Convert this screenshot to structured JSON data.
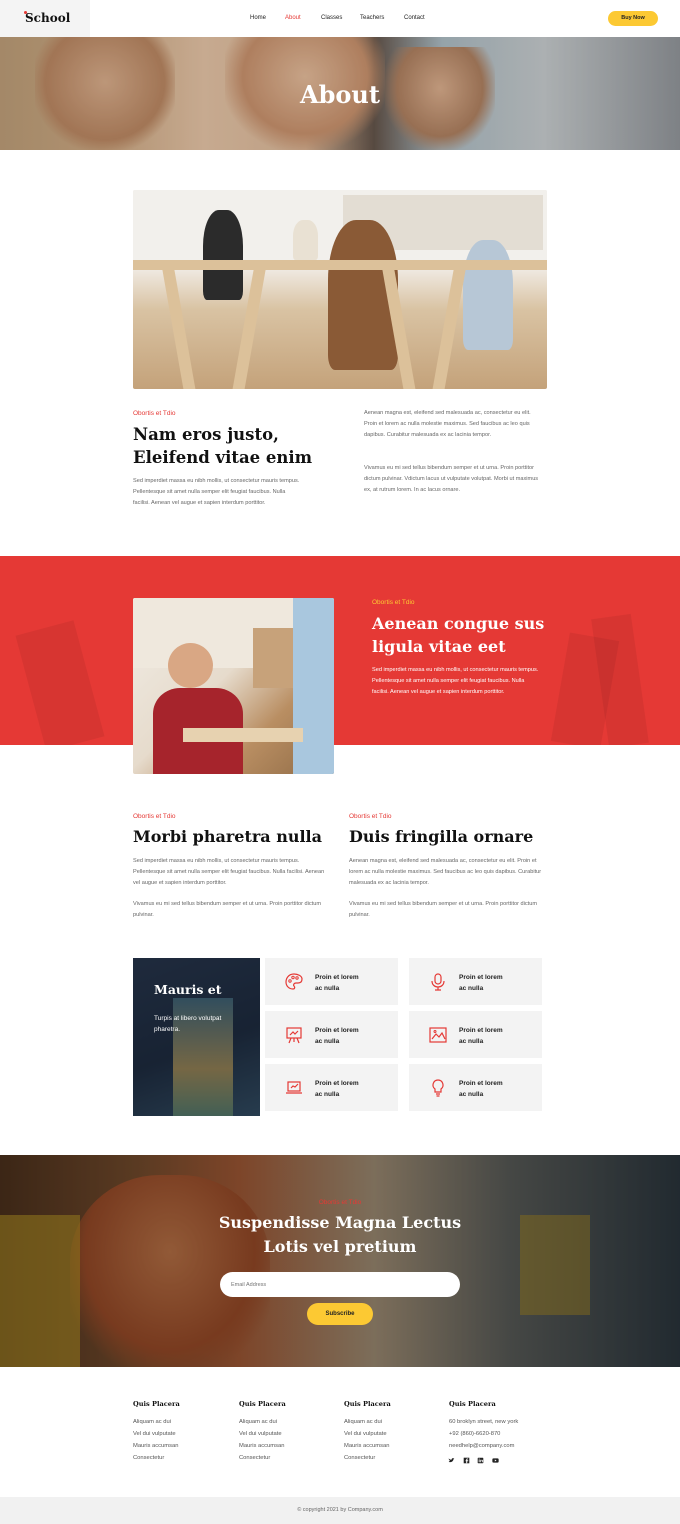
{
  "header": {
    "logo": "School",
    "nav": [
      "Home",
      "About",
      "Classes",
      "Teachers",
      "Contact"
    ],
    "active": "About",
    "cta": "Buy Now"
  },
  "hero": {
    "title": "About"
  },
  "intro": {
    "eyebrow": "Obortis et Tdio",
    "title_line1": "Nam eros justo,",
    "title_line2": "Eleifend vitae enim",
    "body": "Sed imperdiet massa eu nibh mollis, ut consectetur mauris tempus. Pellentesque sit amet nulla semper elit feugiat faucibus. Nulla facilisi. Aenean vel augue et sapien interdum porttitor.",
    "right_p1": "Aenean magna est, eleifend sed malesuada ac, consectetur eu elit. Proin et lorem ac nulla molestie maximus. Sed faucibus ac leo quis dapibus. Curabitur malesuada ex ac lacinia tempor.",
    "right_p2": "Vivamus eu mi sed tellus bibendum semper et ut urna. Proin porttitor dictum pulvinar. Vdictum lacus ut vulputate volutpat. Morbi ut maximus ex, at rutrum lorem. In ac lacus ornare."
  },
  "red_section": {
    "eyebrow": "Obortis et Tdio",
    "title_line1": "Aenean congue sus",
    "title_line2": "ligula vitae eet",
    "body": "Sed imperdiet massa eu nibh mollis, ut consectetur mauris tempus. Pellentesque sit amet nulla semper elit feugiat faucibus. Nulla facilisi. Aenean vel augue et sapien interdum porttitor."
  },
  "two_col": {
    "left": {
      "eyebrow": "Obortis et Tdio",
      "title": "Morbi pharetra nulla",
      "p1": "Sed imperdiet massa eu nibh mollis, ut consectetur mauris tempus. Pellentesque sit amet nulla semper elit feugiat faucibus. Nulla facilisi. Aenean vel augue et sapien interdum porttitor.",
      "p2": "Vivamus eu mi sed tellus bibendum semper et ut urna. Proin porttitor dictum pulvinar."
    },
    "right": {
      "eyebrow": "Obortis et Tdio",
      "title": "Duis fringilla ornare",
      "p1": "Aenean magna est, eleifend sed malesuada ac, consectetur eu elit. Proin et lorem ac nulla molestie maximus. Sed faucibus ac leo quis dapibus. Curabitur malesuada ex ac lacinia tempor.",
      "p2": "Vivamus eu mi sed tellus bibendum semper et ut urna. Proin porttitor dictum pulvinar."
    }
  },
  "features": {
    "card_title": "Mauris et",
    "card_text": "Turpis at libero volutpat pharetra.",
    "items": [
      {
        "line1": "Proin et lorem",
        "line2": "ac nulla",
        "icon": "palette-icon"
      },
      {
        "line1": "Proin et lorem",
        "line2": "ac nulla",
        "icon": "microphone-icon"
      },
      {
        "line1": "Proin et lorem",
        "line2": "ac nulla",
        "icon": "presentation-board-icon"
      },
      {
        "line1": "Proin et lorem",
        "line2": "ac nulla",
        "icon": "image-chart-icon"
      },
      {
        "line1": "Proin et lorem",
        "line2": "ac nulla",
        "icon": "laptop-chart-icon"
      },
      {
        "line1": "Proin et lorem",
        "line2": "ac nulla",
        "icon": "lightbulb-icon"
      }
    ]
  },
  "subscribe": {
    "eyebrow": "Obortis et Tdio",
    "title_line1": "Suspendisse Magna Lectus",
    "title_line2": "Lotis vel pretium",
    "placeholder": "Email Address",
    "button": "Subscribe"
  },
  "footer": {
    "columns": [
      {
        "title": "Quis Placera",
        "links": [
          "Aliquam ac dui",
          "Vel dui vulputate",
          "Mauris accumsan",
          "Consectetur"
        ]
      },
      {
        "title": "Quis Placera",
        "links": [
          "Aliquam ac dui",
          "Vel dui vulputate",
          "Mauris accumsan",
          "Consectetur"
        ]
      },
      {
        "title": "Quis Placera",
        "links": [
          "Aliquam ac dui",
          "Vel dui vulputate",
          "Mauris accumsan",
          "Consectetur"
        ]
      },
      {
        "title": "Quis Placera",
        "links": [
          "60 broklyn street, new york",
          "+92 (860)-6620-870",
          "needhelp@company.com"
        ]
      }
    ],
    "social": [
      "twitter-icon",
      "facebook-icon",
      "linkedin-icon",
      "youtube-icon"
    ],
    "copyright": "© copyright 2021 by Company.com"
  },
  "colors": {
    "accent": "#e53935",
    "button": "#fcc933"
  }
}
